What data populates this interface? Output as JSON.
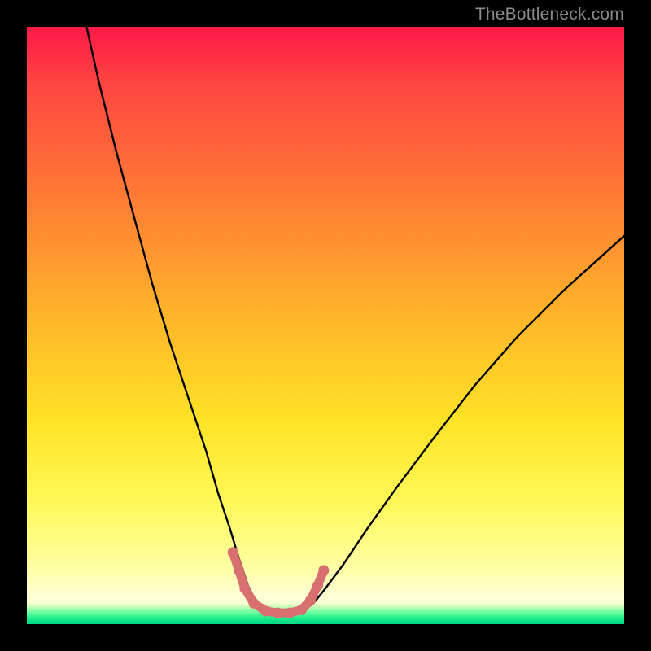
{
  "watermark": {
    "text": "TheBottleneck.com"
  },
  "colors": {
    "frame": "#000000",
    "curve": "#000000",
    "marker": "#d87070",
    "gradient_top": "#ff1a49",
    "gradient_bottom": "#00d988"
  },
  "chart_data": {
    "type": "line",
    "title": "",
    "xlabel": "",
    "ylabel": "",
    "xlim": [
      0,
      100
    ],
    "ylim": [
      0,
      100
    ],
    "grid": false,
    "legend": false,
    "note": "Axes are unlabeled in the image; values are fractional positions (0–100) read from the plot area. Y is plotted inverted (0 at top).",
    "series": [
      {
        "name": "curve",
        "comment": "Black V-shaped bottleneck curve. y is distance from top edge as percent of plot height.",
        "x": [
          10.0,
          12.0,
          15.0,
          18.0,
          21.0,
          24.0,
          27.0,
          30.0,
          32.0,
          34.0,
          35.5,
          37.0,
          38.5,
          40.0,
          42.0,
          44.0,
          46.0,
          48.0,
          50.0,
          53.0,
          57.0,
          62.0,
          68.0,
          75.0,
          82.0,
          90.0,
          100.0
        ],
        "y": [
          0.0,
          9.0,
          21.0,
          32.0,
          43.0,
          53.0,
          62.0,
          71.0,
          78.0,
          84.0,
          89.0,
          93.5,
          96.5,
          98.0,
          98.3,
          98.3,
          98.0,
          96.5,
          94.0,
          90.0,
          84.0,
          77.0,
          69.0,
          60.0,
          52.0,
          44.0,
          35.0
        ]
      },
      {
        "name": "marker-band",
        "comment": "Salmon dotted band hugging the valley floor of the curve.",
        "x": [
          34.5,
          35.5,
          36.5,
          38.0,
          40.0,
          42.0,
          44.0,
          46.0,
          47.5,
          48.7,
          49.7
        ],
        "y": [
          88.0,
          91.0,
          94.0,
          96.5,
          97.8,
          98.1,
          98.1,
          97.6,
          96.0,
          93.5,
          91.0
        ]
      }
    ]
  }
}
